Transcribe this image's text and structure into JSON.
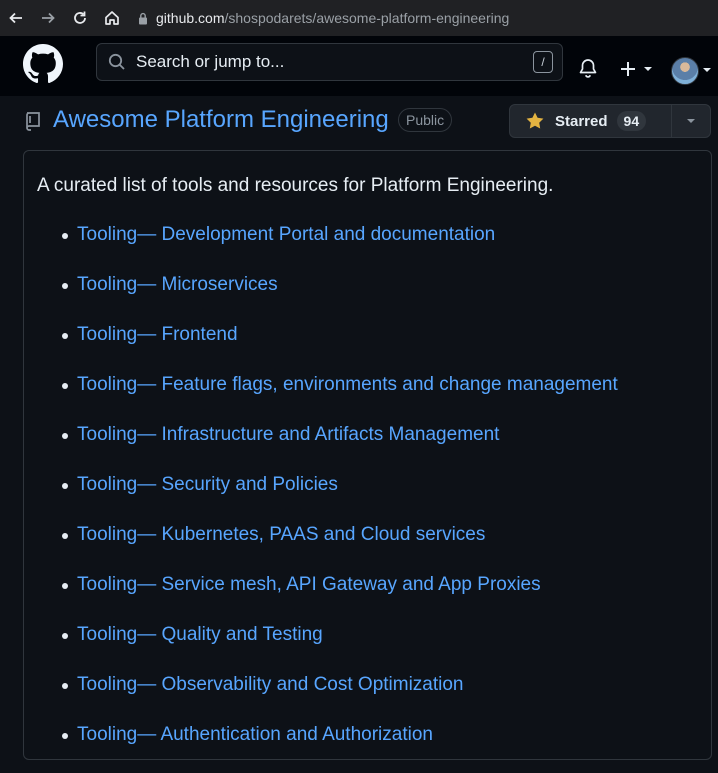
{
  "browser": {
    "url_host": "github.com",
    "url_path": "/shospodarets/awesome-platform-engineering"
  },
  "header": {
    "search_placeholder": "Search or jump to...",
    "search_shortcut": "/"
  },
  "repo": {
    "title": "Awesome Platform Engineering",
    "visibility": "Public",
    "star_label": "Starred",
    "star_count": "94"
  },
  "readme": {
    "intro": "A curated list of tools and resources for Platform Engineering.",
    "items": [
      "Tooling— Development Portal and documentation",
      "Tooling— Microservices",
      "Tooling— Frontend",
      "Tooling— Feature flags, environments and change management",
      "Tooling— Infrastructure and Artifacts Management",
      "Tooling— Security and Policies",
      "Tooling— Kubernetes, PAAS and Cloud services",
      "Tooling— Service mesh, API Gateway and App Proxies",
      "Tooling— Quality and Testing",
      "Tooling— Observability and Cost Optimization",
      "Tooling— Authentication and Authorization"
    ]
  },
  "colors": {
    "link": "#58a6ff",
    "background": "#0d1117",
    "header_bg": "#010409",
    "star": "#e3b341"
  }
}
